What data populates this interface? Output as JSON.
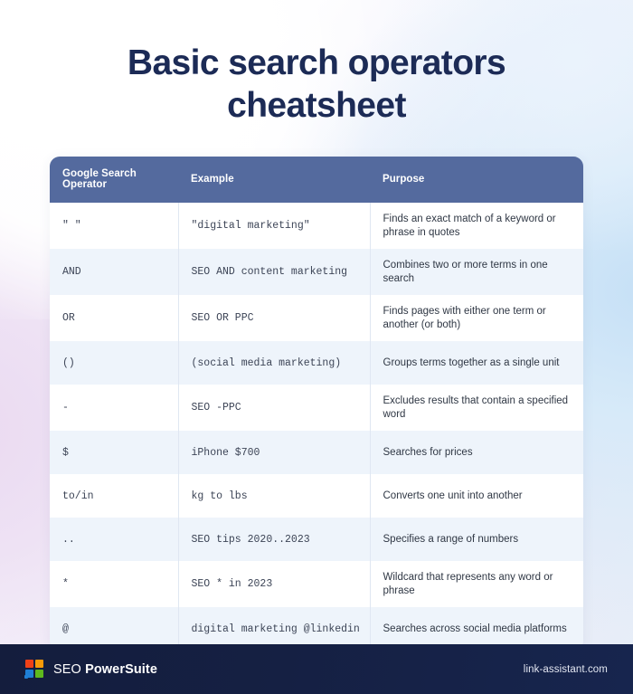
{
  "page": {
    "title_line1": "Basic search operators",
    "title_line2": "cheatsheet",
    "title_color": "#1c2b56",
    "header_bg": "#546a9e",
    "row_alt_bg": "#eef4fb",
    "footer_bg": "#141d3d"
  },
  "table": {
    "columns": [
      "Google Search Operator",
      "Example",
      "Purpose"
    ],
    "rows": [
      {
        "operator": "\" \"",
        "example": "\"digital marketing\"",
        "purpose": "Finds an exact match of a keyword or phrase in quotes"
      },
      {
        "operator": "AND",
        "example": "SEO AND content marketing",
        "purpose": "Combines two or more terms in one search"
      },
      {
        "operator": "OR",
        "example": "SEO OR PPC",
        "purpose": "Finds pages with either one term or another (or both)"
      },
      {
        "operator": "()",
        "example": "(social media marketing)",
        "purpose": "Groups terms together as a single unit"
      },
      {
        "operator": "-",
        "example": "SEO -PPC",
        "purpose": "Excludes results that contain a specified word"
      },
      {
        "operator": "$",
        "example": "iPhone $700",
        "purpose": "Searches for prices"
      },
      {
        "operator": "to/in",
        "example": "kg to lbs",
        "purpose": "Converts one unit into another"
      },
      {
        "operator": "..",
        "example": "SEO tips 2020..2023",
        "purpose": "Specifies a range of numbers"
      },
      {
        "operator": "*",
        "example": "SEO * in 2023",
        "purpose": "Wildcard that represents any word or phrase"
      },
      {
        "operator": "@",
        "example": "digital marketing @linkedin",
        "purpose": "Searches across social media platforms"
      }
    ]
  },
  "footer": {
    "brand_light": "SEO ",
    "brand_bold": "PowerSuite",
    "site_url": "link-assistant.com",
    "logo_colors": {
      "top_left": "#ef4117",
      "top_right": "#f79a08",
      "bottom_left": "#1f7fd6",
      "bottom_right": "#5eb91e"
    }
  }
}
